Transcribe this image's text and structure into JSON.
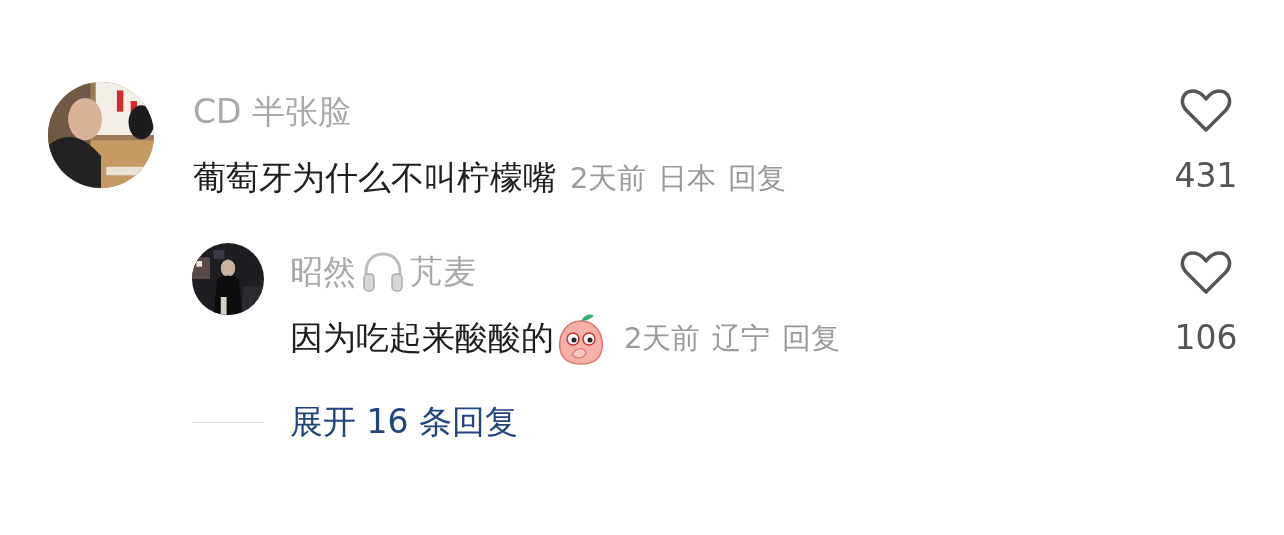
{
  "comments": [
    {
      "name": [
        "CD 半张脸"
      ],
      "text": "葡萄牙为什么不叫柠檬嘴",
      "sticker": false,
      "time": "2天前",
      "location": "日本",
      "reply_label": "回复",
      "liked": false,
      "likes": "431",
      "avatar": {
        "kind": "picture"
      },
      "replies": [
        {
          "name": [
            "昭然",
            "芃麦"
          ],
          "text": "因为吃起来酸酸的",
          "sticker": true,
          "time": "2天前",
          "location": "辽宁",
          "reply_label": "回复",
          "liked": false,
          "likes": "106",
          "avatar": {
            "kind": "picture"
          }
        }
      ],
      "expand_label": "展开 16 条回复"
    }
  ]
}
